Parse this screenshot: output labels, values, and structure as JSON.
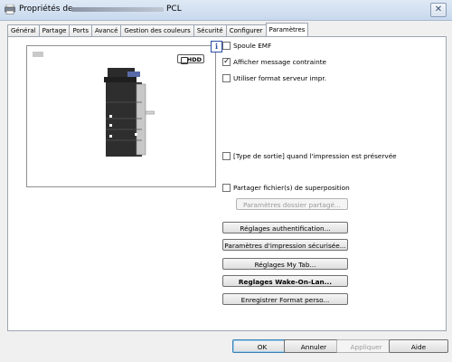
{
  "window": {
    "title_prefix": "Propriétés de",
    "title_suffix": "PCL",
    "close_label": "✕"
  },
  "tabs": [
    {
      "label": "Général"
    },
    {
      "label": "Partage"
    },
    {
      "label": "Ports"
    },
    {
      "label": "Avancé"
    },
    {
      "label": "Gestion des couleurs"
    },
    {
      "label": "Sécurité"
    },
    {
      "label": "Configurer"
    },
    {
      "label": "Paramètres",
      "active": true
    }
  ],
  "preview": {
    "hdd_badge": "HDD",
    "info_icon": "i"
  },
  "options": {
    "spool_emf": {
      "label": "Spoule EMF",
      "checked": false
    },
    "show_message": {
      "label": "Afficher message contrainte",
      "checked": true
    },
    "server_format": {
      "label": "Utiliser format serveur impr.",
      "checked": false
    },
    "output_type": {
      "label": "[Type de sortie] quand l'impression est préservée",
      "checked": false
    },
    "share_overlay": {
      "label": "Partager fichier(s) de superposition",
      "checked": false
    }
  },
  "buttons": {
    "shared_folder": "Paramètres dossier partagé...",
    "auth_settings": "Réglages authentification...",
    "secure_print": "Paramètres d'impression sécurisée...",
    "my_tab": "Réglages My Tab...",
    "wake_on_lan": "Reglages Wake-On-Lan...",
    "save_custom_format": "Enregistrer Format perso..."
  },
  "footer": {
    "ok": "OK",
    "cancel": "Annuler",
    "apply": "Appliquer",
    "help": "Aide"
  }
}
